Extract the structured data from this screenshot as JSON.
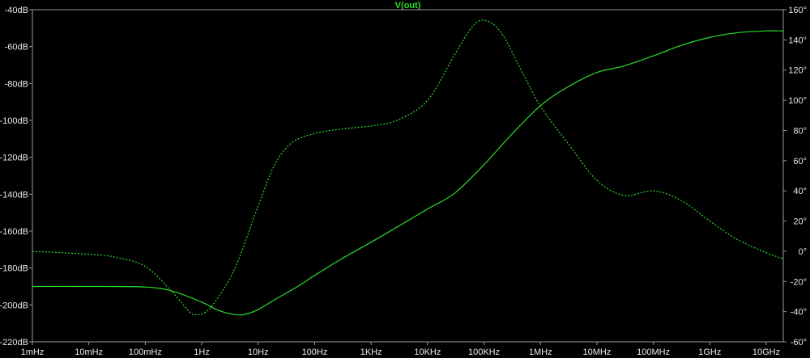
{
  "chart_data": {
    "type": "line",
    "title": "V(out)",
    "grid": false,
    "colors": {
      "background": "#000000",
      "axes": "#9a9a9a",
      "trace": "#2bdc2b",
      "title": "#2bdc2b",
      "tick_text": "#e8e8e8"
    },
    "x_axis": {
      "scale": "log",
      "unit": "Hz",
      "range": [
        0.001,
        20000000000
      ],
      "ticks": [
        {
          "value": 0.001,
          "label": "1mHz"
        },
        {
          "value": 0.01,
          "label": "10mHz"
        },
        {
          "value": 0.1,
          "label": "100mHz"
        },
        {
          "value": 1,
          "label": "1Hz"
        },
        {
          "value": 10,
          "label": "10Hz"
        },
        {
          "value": 100,
          "label": "100Hz"
        },
        {
          "value": 1000,
          "label": "1KHz"
        },
        {
          "value": 10000,
          "label": "10KHz"
        },
        {
          "value": 100000,
          "label": "100KHz"
        },
        {
          "value": 1000000,
          "label": "1MHz"
        },
        {
          "value": 10000000,
          "label": "10MHz"
        },
        {
          "value": 100000000,
          "label": "100MHz"
        },
        {
          "value": 1000000000,
          "label": "1GHz"
        },
        {
          "value": 10000000000,
          "label": "10GHz"
        }
      ]
    },
    "y_left": {
      "unit": "dB",
      "range": [
        -220,
        -40
      ],
      "ticks": [
        {
          "value": -40,
          "label": "-40dB"
        },
        {
          "value": -60,
          "label": "-60dB"
        },
        {
          "value": -80,
          "label": "-80dB"
        },
        {
          "value": -100,
          "label": "-100dB"
        },
        {
          "value": -120,
          "label": "-120dB"
        },
        {
          "value": -140,
          "label": "-140dB"
        },
        {
          "value": -160,
          "label": "-160dB"
        },
        {
          "value": -180,
          "label": "-180dB"
        },
        {
          "value": -200,
          "label": "-200dB"
        },
        {
          "value": -220,
          "label": "-220dB"
        }
      ]
    },
    "y_right": {
      "unit": "°",
      "range": [
        -60,
        160
      ],
      "ticks": [
        {
          "value": 160,
          "label": "160°"
        },
        {
          "value": 140,
          "label": "140°"
        },
        {
          "value": 120,
          "label": "120°"
        },
        {
          "value": 100,
          "label": "100°"
        },
        {
          "value": 80,
          "label": "80°"
        },
        {
          "value": 60,
          "label": "60°"
        },
        {
          "value": 40,
          "label": "40°"
        },
        {
          "value": 20,
          "label": "20°"
        },
        {
          "value": 0,
          "label": "0°"
        },
        {
          "value": -20,
          "label": "-20°"
        },
        {
          "value": -40,
          "label": "-40°"
        },
        {
          "value": -60,
          "label": "-60°"
        }
      ]
    },
    "series": [
      {
        "axis": "left",
        "style": "solid",
        "x": [
          0.001,
          0.01,
          0.1,
          0.3,
          1,
          2,
          4,
          6,
          10,
          20,
          50,
          100,
          300,
          1000,
          3000,
          10000,
          30000,
          100000,
          300000,
          1000000,
          3000000,
          10000000,
          30000000,
          100000000,
          300000000,
          1000000000,
          3000000000,
          10000000000,
          20000000000
        ],
        "values": [
          -190,
          -190,
          -190.3,
          -192.5,
          -198.5,
          -203,
          -205.3,
          -205,
          -202.5,
          -197,
          -190,
          -184,
          -175,
          -166,
          -157.5,
          -148,
          -139.5,
          -124,
          -108,
          -92,
          -82,
          -74,
          -70.5,
          -65,
          -59.5,
          -55,
          -52.5,
          -51.5,
          -51.5
        ]
      },
      {
        "axis": "right",
        "style": "dashed",
        "x": [
          0.001,
          0.01,
          0.03,
          0.1,
          0.3,
          0.6,
          0.8,
          1.2,
          2,
          4,
          10,
          20,
          40,
          100,
          300,
          1000,
          3000,
          10000,
          30000,
          60000,
          100000,
          200000,
          500000,
          1000000,
          3000000,
          10000000,
          30000000,
          100000000,
          300000000,
          1000000000,
          3000000000,
          10000000000,
          20000000000
        ],
        "values": [
          0,
          -2,
          -4,
          -10,
          -27,
          -40,
          -42,
          -40,
          -30,
          -10,
          30,
          58,
          72,
          78,
          81,
          83,
          87,
          100,
          130,
          148,
          153,
          145,
          117,
          96,
          72,
          47,
          37,
          40,
          34,
          20,
          8,
          -1,
          -5
        ]
      }
    ]
  }
}
